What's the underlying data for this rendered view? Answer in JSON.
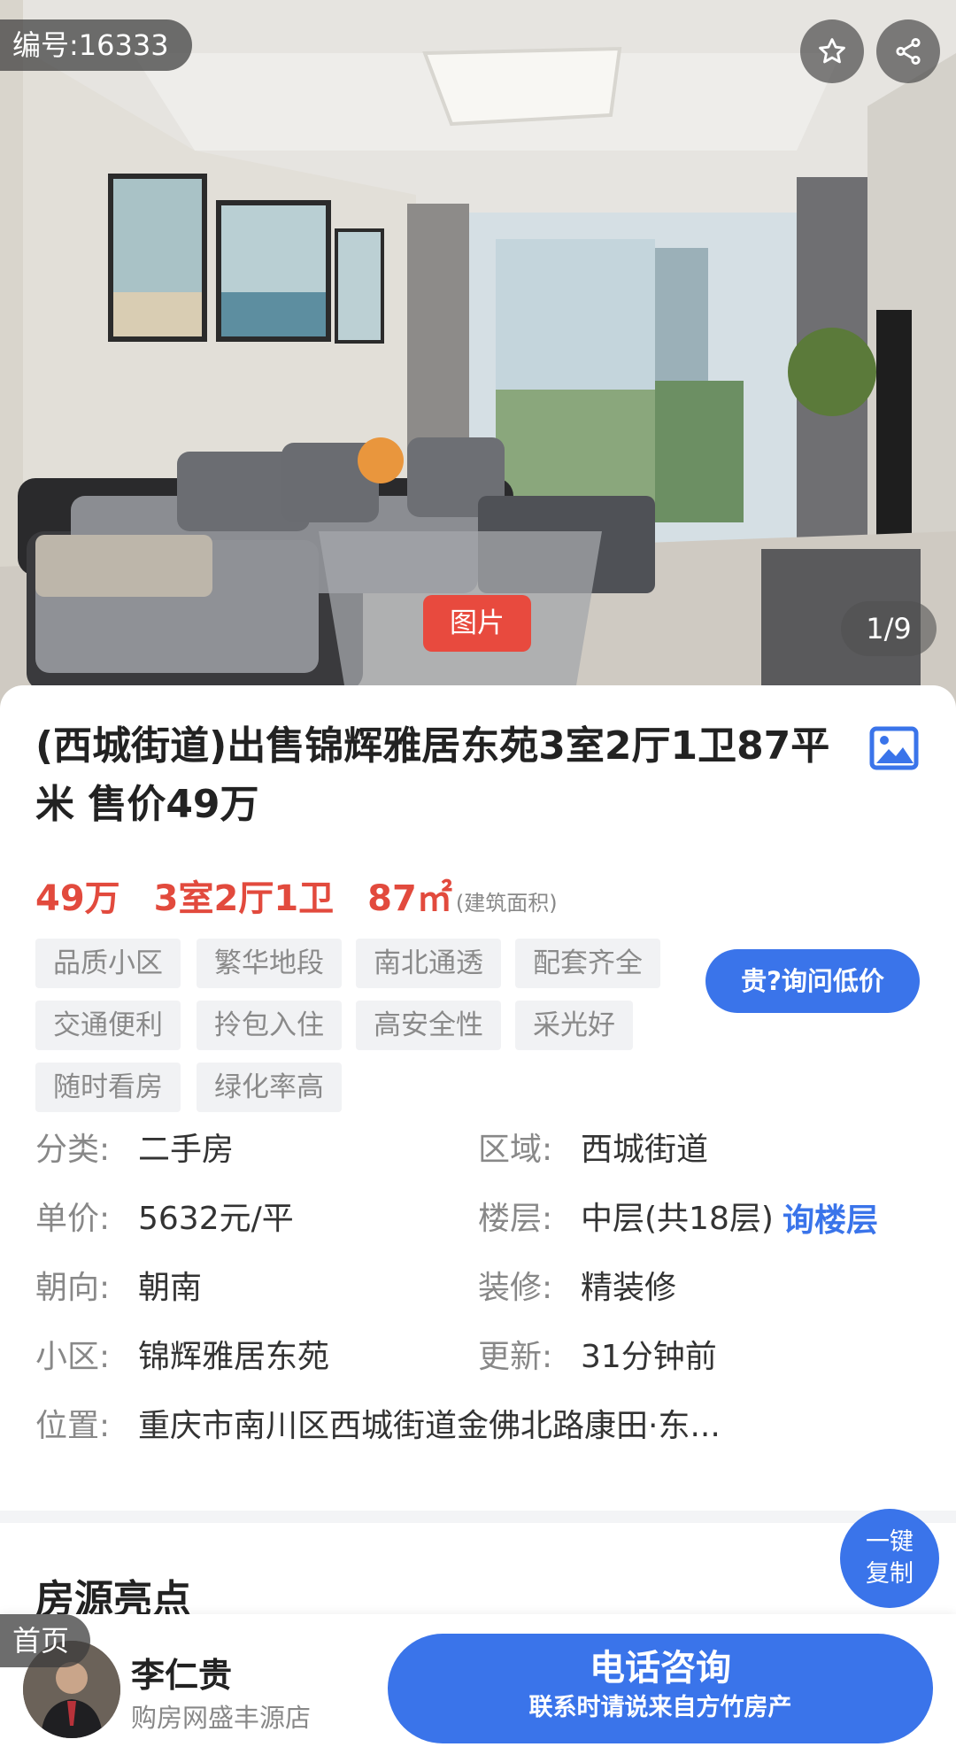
{
  "hero": {
    "listing_id": "编号:16333",
    "photo_tab": "图片",
    "photo_counter": "1/9"
  },
  "listing": {
    "title": "(西城街道)出售锦辉雅居东苑3室2厅1卫87平米 售价49万",
    "price": "49万",
    "layout": "3室2厅1卫",
    "area": "87㎡",
    "area_note": "(建筑面积)",
    "tags": [
      "品质小区",
      "繁华地段",
      "南北通透",
      "配套齐全",
      "交通便利",
      "拎包入住",
      "高安全性",
      "采光好",
      "随时看房",
      "绿化率高"
    ],
    "ask_price_label": "贵?询问低价"
  },
  "info": {
    "category_label": "分类:",
    "category_value": "二手房",
    "region_label": "区域:",
    "region_value": "西城街道",
    "unit_price_label": "单价:",
    "unit_price_value": "5632元/平",
    "floor_label": "楼层:",
    "floor_value": "中层(共18层)",
    "ask_floor": "询楼层",
    "orientation_label": "朝向:",
    "orientation_value": "朝南",
    "decoration_label": "装修:",
    "decoration_value": "精装修",
    "community_label": "小区:",
    "community_value": "锦辉雅居东苑",
    "updated_label": "更新:",
    "updated_value": "31分钟前",
    "location_label": "位置:",
    "location_value": "重庆市南川区西城街道金佛北路康田·东..."
  },
  "section": {
    "highlights_title": "房源亮点"
  },
  "copy_button": {
    "line1": "一键",
    "line2": "复制"
  },
  "bottom_bar": {
    "home_label": "首页",
    "agent_name": "李仁贵",
    "agent_shop": "购房网盛丰源店",
    "call_label": "电话咨询",
    "call_sub": "联系时请说来自方竹房产"
  },
  "colors": {
    "accent_blue": "#3a74ea",
    "price_red": "#e24a3d",
    "photo_tab_red": "#e84a3e"
  },
  "icons": [
    "star-icon",
    "share-icon",
    "gallery-icon"
  ]
}
